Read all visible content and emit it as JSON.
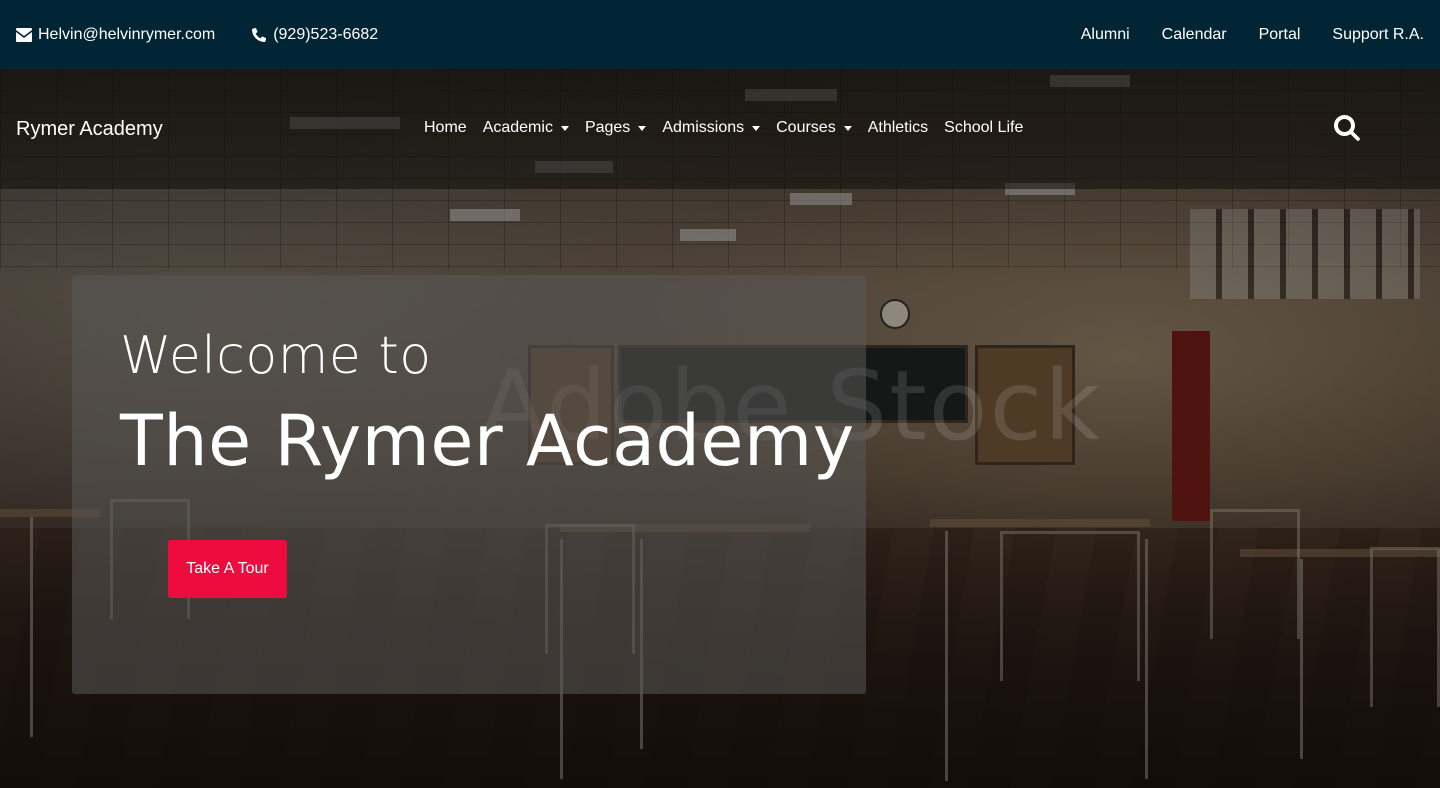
{
  "topbar": {
    "email": "Helvin@helvinrymer.com",
    "phone": "(929)523-6682",
    "links": [
      "Alumni",
      "Calendar",
      "Portal",
      "Support R.A."
    ]
  },
  "navbar": {
    "brand": "Rymer Academy",
    "items": [
      {
        "label": "Home",
        "dropdown": false
      },
      {
        "label": "Academic",
        "dropdown": true
      },
      {
        "label": "Pages",
        "dropdown": true
      },
      {
        "label": "Admissions",
        "dropdown": true
      },
      {
        "label": "Courses",
        "dropdown": true
      },
      {
        "label": "Athletics",
        "dropdown": false
      },
      {
        "label": "School Life",
        "dropdown": false
      }
    ],
    "search_icon": "search-icon"
  },
  "hero": {
    "welcome": "Welcome to",
    "title": "The Rymer Academy",
    "cta_label": "Take A Tour",
    "watermark": "Adobe Stock"
  },
  "colors": {
    "topbar_bg": "#022535",
    "cta_bg": "#ee0b3e"
  }
}
